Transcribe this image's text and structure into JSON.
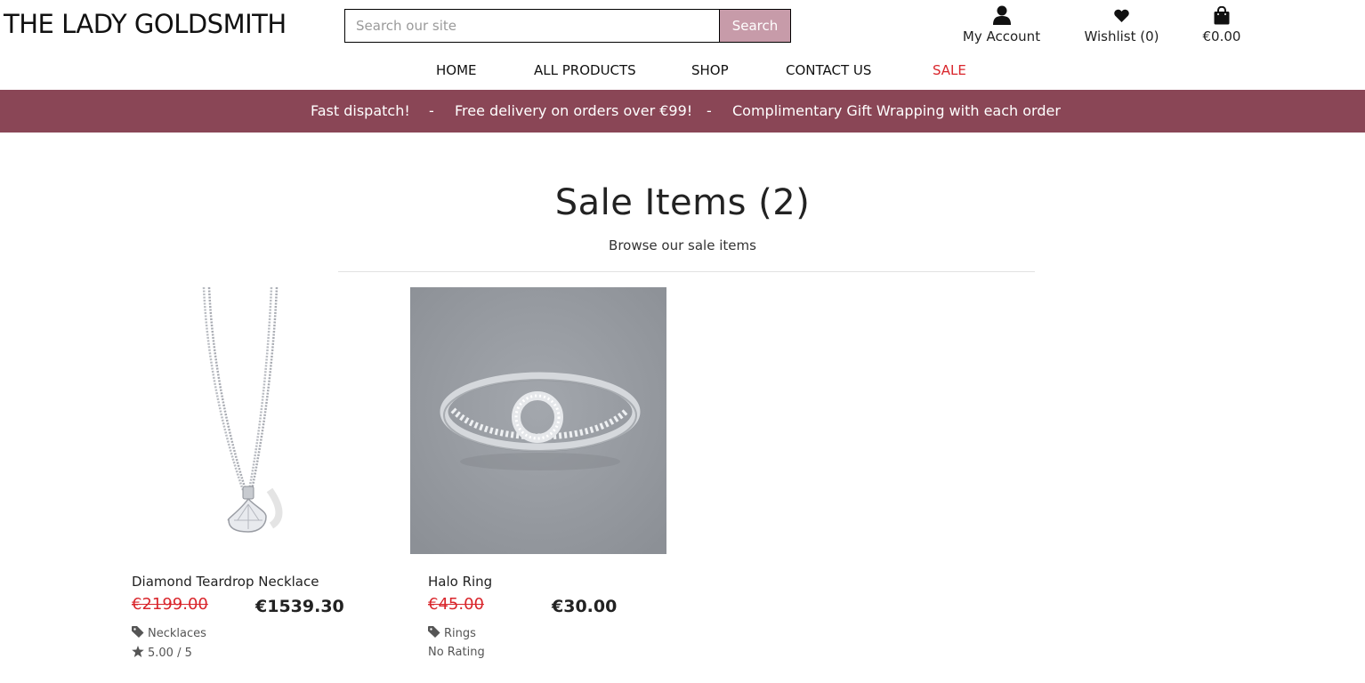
{
  "header": {
    "logo": "THE LADY GOLDSMITH",
    "search": {
      "placeholder": "Search our site",
      "button": "Search"
    },
    "account": {
      "label": "My Account",
      "icon": "user-icon"
    },
    "wishlist": {
      "label": "Wishlist (0)",
      "icon": "heart-icon"
    },
    "bag": {
      "label": "€0.00",
      "icon": "shopping-bag-icon"
    }
  },
  "nav": {
    "items": [
      {
        "label": "HOME"
      },
      {
        "label": "ALL PRODUCTS"
      },
      {
        "label": "SHOP"
      },
      {
        "label": "CONTACT US"
      },
      {
        "label": "SALE"
      }
    ]
  },
  "banner": {
    "items": [
      "Fast dispatch!",
      "-",
      "Free delivery on orders over €99!",
      "-",
      "Complimentary Gift Wrapping with each order"
    ],
    "color": "#8a4656"
  },
  "main": {
    "title": "Sale Items (2)",
    "subtitle": "Browse our sale items",
    "products": [
      {
        "name": "Diamond Teardrop Necklace",
        "old_price": "€2199.00",
        "price": "€1539.30",
        "category": "Necklaces",
        "rating": "5.00 / 5"
      },
      {
        "name": "Halo Ring",
        "old_price": "€45.00",
        "price": "€30.00",
        "category": "Rings",
        "rating": "No Rating"
      }
    ]
  },
  "colors": {
    "accent": "#c79ba9",
    "sale": "#d9252b",
    "banner": "#8a4656"
  }
}
